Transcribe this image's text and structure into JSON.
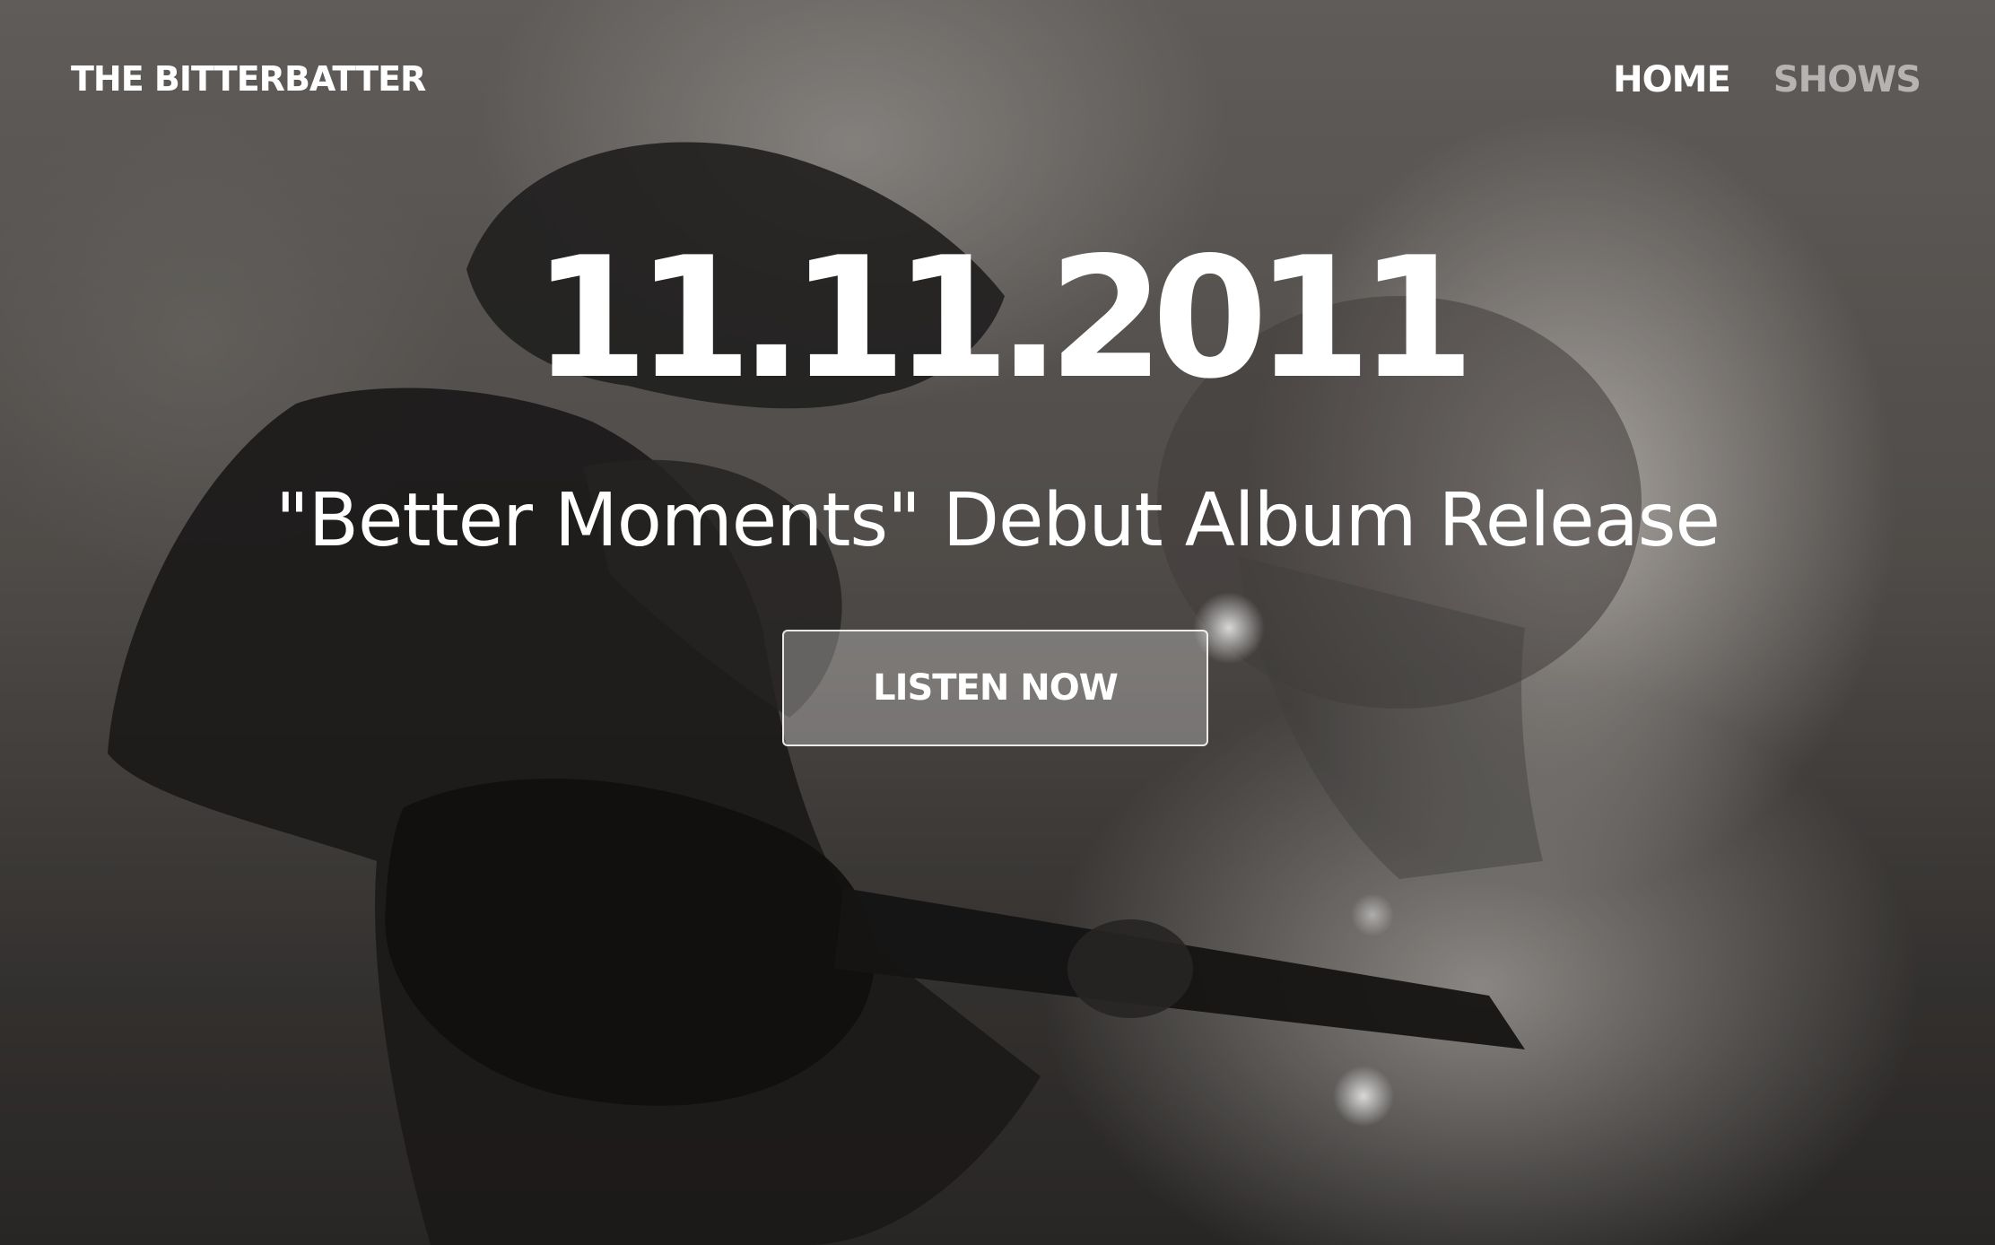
{
  "header": {
    "brand": "THE BITTERBATTER",
    "nav": [
      {
        "label": "HOME",
        "active": true
      },
      {
        "label": "SHOWS",
        "active": false
      }
    ]
  },
  "hero": {
    "date": "11.11.2011",
    "subtitle": "\"Better Moments\" Debut Album Release",
    "cta_label": "LISTEN NOW",
    "background": "black-and-white photo of a guitarist performing on a smoky stage"
  },
  "colors": {
    "text": "#ffffff",
    "nav_inactive": "#bdbab7"
  }
}
